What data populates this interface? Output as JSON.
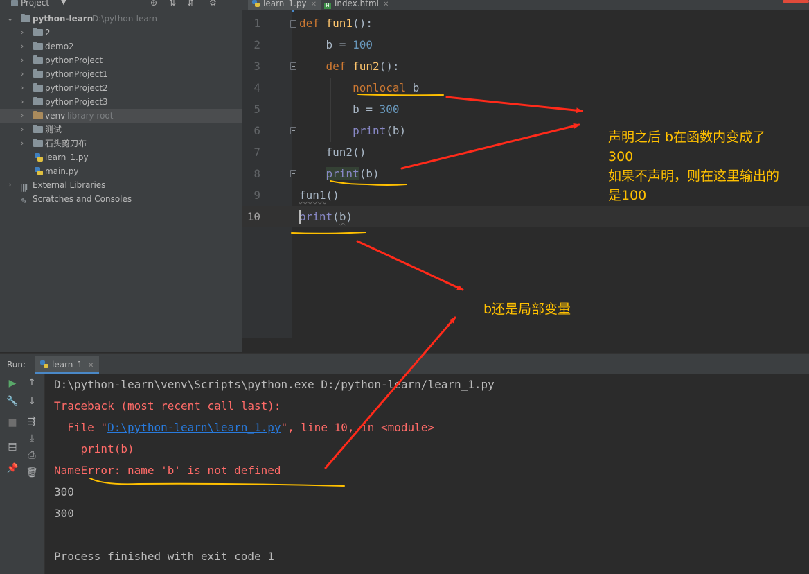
{
  "project_panel": {
    "title": "Project",
    "tree": [
      {
        "label": "python-learn",
        "suffix": "D:\\python-learn",
        "type": "root"
      },
      {
        "label": "2",
        "type": "folder"
      },
      {
        "label": "demo2",
        "type": "folder"
      },
      {
        "label": "pythonProject",
        "type": "folder"
      },
      {
        "label": "pythonProject1",
        "type": "folder"
      },
      {
        "label": "pythonProject2",
        "type": "folder"
      },
      {
        "label": "pythonProject3",
        "type": "folder"
      },
      {
        "label": "venv",
        "suffix": "library root",
        "type": "folder",
        "selected": true
      },
      {
        "label": "测试",
        "type": "folder"
      },
      {
        "label": "石头剪刀布",
        "type": "folder"
      },
      {
        "label": "learn_1.py",
        "type": "py"
      },
      {
        "label": "main.py",
        "type": "py"
      },
      {
        "label": "External Libraries",
        "type": "lib"
      },
      {
        "label": "Scratches and Consoles",
        "type": "scratch"
      }
    ]
  },
  "editor": {
    "tabs": [
      {
        "label": "learn_1.py",
        "active": true
      },
      {
        "label": "index.html",
        "active": false
      }
    ],
    "line_numbers": [
      "1",
      "2",
      "3",
      "4",
      "5",
      "6",
      "7",
      "8",
      "9",
      "10"
    ],
    "current_line": "10"
  },
  "run_panel": {
    "label": "Run:",
    "tab": "learn_1",
    "console_lines": [
      {
        "text": "D:\\python-learn\\venv\\Scripts\\python.exe D:/python-learn/learn_1.py",
        "kind": "normal"
      },
      {
        "text": "Traceback (most recent call last):",
        "kind": "err"
      },
      {
        "pre": "  File \"",
        "link": "D:\\python-learn\\learn_1.py",
        "post": "\", line 10, in <module>",
        "kind": "err"
      },
      {
        "text": "    print(b)",
        "kind": "err"
      },
      {
        "text": "NameError: name 'b' is not defined",
        "kind": "err"
      },
      {
        "text": "300",
        "kind": "normal"
      },
      {
        "text": "300",
        "kind": "normal"
      },
      {
        "text": "",
        "kind": "normal"
      },
      {
        "text": "Process finished with exit code 1",
        "kind": "normal"
      }
    ]
  },
  "annotations": {
    "note1_line1": "声明之后 b在函数内变成了",
    "note1_line2": "300",
    "note1_line3": "如果不声明，则在这里输出的",
    "note1_line4": "是100",
    "note2": "b还是局部变量",
    "colors": {
      "arrow": "#ff2a1a",
      "underline": "#ffc000",
      "text": "#ffc000"
    }
  },
  "colors": {
    "keyword": "#cc7832",
    "function": "#ffc66d",
    "number": "#6897bb",
    "builtin": "#8888c6",
    "error": "#ff6b68",
    "link": "#287bde"
  }
}
